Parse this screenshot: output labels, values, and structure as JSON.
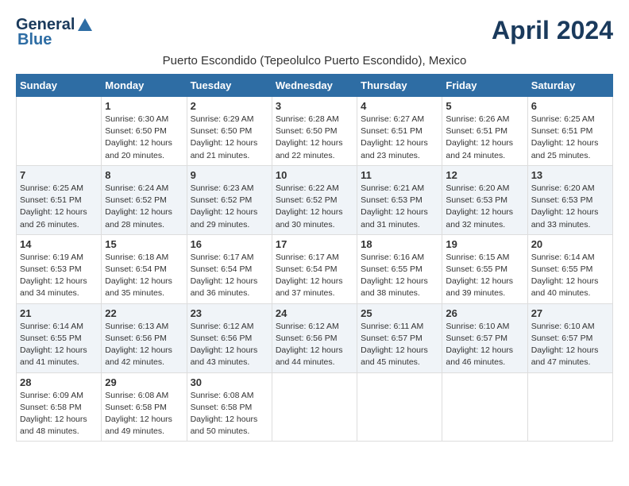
{
  "header": {
    "logo_line1": "General",
    "logo_line2": "Blue",
    "month_title": "April 2024",
    "location": "Puerto Escondido (Tepeolulco Puerto Escondido), Mexico"
  },
  "days_of_week": [
    "Sunday",
    "Monday",
    "Tuesday",
    "Wednesday",
    "Thursday",
    "Friday",
    "Saturday"
  ],
  "weeks": [
    [
      {
        "day": "",
        "info": ""
      },
      {
        "day": "1",
        "info": "Sunrise: 6:30 AM\nSunset: 6:50 PM\nDaylight: 12 hours\nand 20 minutes."
      },
      {
        "day": "2",
        "info": "Sunrise: 6:29 AM\nSunset: 6:50 PM\nDaylight: 12 hours\nand 21 minutes."
      },
      {
        "day": "3",
        "info": "Sunrise: 6:28 AM\nSunset: 6:50 PM\nDaylight: 12 hours\nand 22 minutes."
      },
      {
        "day": "4",
        "info": "Sunrise: 6:27 AM\nSunset: 6:51 PM\nDaylight: 12 hours\nand 23 minutes."
      },
      {
        "day": "5",
        "info": "Sunrise: 6:26 AM\nSunset: 6:51 PM\nDaylight: 12 hours\nand 24 minutes."
      },
      {
        "day": "6",
        "info": "Sunrise: 6:25 AM\nSunset: 6:51 PM\nDaylight: 12 hours\nand 25 minutes."
      }
    ],
    [
      {
        "day": "7",
        "info": "Sunrise: 6:25 AM\nSunset: 6:51 PM\nDaylight: 12 hours\nand 26 minutes."
      },
      {
        "day": "8",
        "info": "Sunrise: 6:24 AM\nSunset: 6:52 PM\nDaylight: 12 hours\nand 28 minutes."
      },
      {
        "day": "9",
        "info": "Sunrise: 6:23 AM\nSunset: 6:52 PM\nDaylight: 12 hours\nand 29 minutes."
      },
      {
        "day": "10",
        "info": "Sunrise: 6:22 AM\nSunset: 6:52 PM\nDaylight: 12 hours\nand 30 minutes."
      },
      {
        "day": "11",
        "info": "Sunrise: 6:21 AM\nSunset: 6:53 PM\nDaylight: 12 hours\nand 31 minutes."
      },
      {
        "day": "12",
        "info": "Sunrise: 6:20 AM\nSunset: 6:53 PM\nDaylight: 12 hours\nand 32 minutes."
      },
      {
        "day": "13",
        "info": "Sunrise: 6:20 AM\nSunset: 6:53 PM\nDaylight: 12 hours\nand 33 minutes."
      }
    ],
    [
      {
        "day": "14",
        "info": "Sunrise: 6:19 AM\nSunset: 6:53 PM\nDaylight: 12 hours\nand 34 minutes."
      },
      {
        "day": "15",
        "info": "Sunrise: 6:18 AM\nSunset: 6:54 PM\nDaylight: 12 hours\nand 35 minutes."
      },
      {
        "day": "16",
        "info": "Sunrise: 6:17 AM\nSunset: 6:54 PM\nDaylight: 12 hours\nand 36 minutes."
      },
      {
        "day": "17",
        "info": "Sunrise: 6:17 AM\nSunset: 6:54 PM\nDaylight: 12 hours\nand 37 minutes."
      },
      {
        "day": "18",
        "info": "Sunrise: 6:16 AM\nSunset: 6:55 PM\nDaylight: 12 hours\nand 38 minutes."
      },
      {
        "day": "19",
        "info": "Sunrise: 6:15 AM\nSunset: 6:55 PM\nDaylight: 12 hours\nand 39 minutes."
      },
      {
        "day": "20",
        "info": "Sunrise: 6:14 AM\nSunset: 6:55 PM\nDaylight: 12 hours\nand 40 minutes."
      }
    ],
    [
      {
        "day": "21",
        "info": "Sunrise: 6:14 AM\nSunset: 6:55 PM\nDaylight: 12 hours\nand 41 minutes."
      },
      {
        "day": "22",
        "info": "Sunrise: 6:13 AM\nSunset: 6:56 PM\nDaylight: 12 hours\nand 42 minutes."
      },
      {
        "day": "23",
        "info": "Sunrise: 6:12 AM\nSunset: 6:56 PM\nDaylight: 12 hours\nand 43 minutes."
      },
      {
        "day": "24",
        "info": "Sunrise: 6:12 AM\nSunset: 6:56 PM\nDaylight: 12 hours\nand 44 minutes."
      },
      {
        "day": "25",
        "info": "Sunrise: 6:11 AM\nSunset: 6:57 PM\nDaylight: 12 hours\nand 45 minutes."
      },
      {
        "day": "26",
        "info": "Sunrise: 6:10 AM\nSunset: 6:57 PM\nDaylight: 12 hours\nand 46 minutes."
      },
      {
        "day": "27",
        "info": "Sunrise: 6:10 AM\nSunset: 6:57 PM\nDaylight: 12 hours\nand 47 minutes."
      }
    ],
    [
      {
        "day": "28",
        "info": "Sunrise: 6:09 AM\nSunset: 6:58 PM\nDaylight: 12 hours\nand 48 minutes."
      },
      {
        "day": "29",
        "info": "Sunrise: 6:08 AM\nSunset: 6:58 PM\nDaylight: 12 hours\nand 49 minutes."
      },
      {
        "day": "30",
        "info": "Sunrise: 6:08 AM\nSunset: 6:58 PM\nDaylight: 12 hours\nand 50 minutes."
      },
      {
        "day": "",
        "info": ""
      },
      {
        "day": "",
        "info": ""
      },
      {
        "day": "",
        "info": ""
      },
      {
        "day": "",
        "info": ""
      }
    ]
  ]
}
